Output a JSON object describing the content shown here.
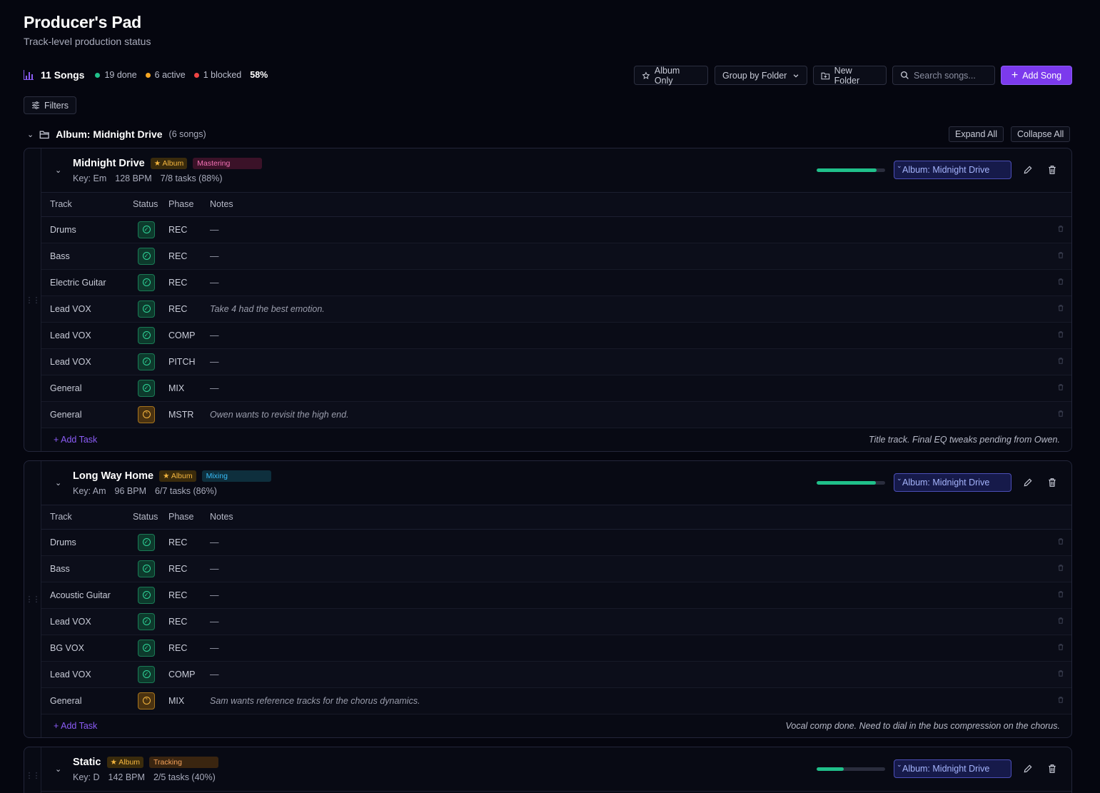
{
  "app": {
    "title": "Producer's Pad",
    "subtitle": "Track-level production status"
  },
  "stats": {
    "songs": "11 Songs",
    "done": "19 done",
    "active": "6 active",
    "blocked": "1 blocked",
    "percent": "58%",
    "colors": {
      "done": "#20c08a",
      "active": "#f5a623",
      "blocked": "#ef4444"
    }
  },
  "toolbar": {
    "album_only": "Album Only",
    "group_by": "Group by Folder",
    "new_folder": "New Folder",
    "search_placeholder": "Search songs...",
    "add_song": "Add Song"
  },
  "filters": {
    "label": "Filters"
  },
  "folder": {
    "title": "Album: Midnight Drive",
    "count": "(6 songs)",
    "expand_all": "Expand All",
    "collapse_all": "Collapse All"
  },
  "columns": {
    "track": "Track",
    "status": "Status",
    "phase": "Phase",
    "notes": "Notes"
  },
  "add_task": "Add Task",
  "songs": [
    {
      "title": "Midnight Drive",
      "album_badge": "Album",
      "phase": "Mastering",
      "phase_bg": "#3b1228",
      "phase_fg": "#f472b6",
      "key": "Key: Em",
      "bpm": "128 BPM",
      "tasks": "7/8 tasks (88%)",
      "progress": 0.88,
      "folder": "Album: Midnight Drive",
      "rows": [
        {
          "track": "Drums",
          "status": "done",
          "phase": "REC",
          "notes": "—"
        },
        {
          "track": "Bass",
          "status": "done",
          "phase": "REC",
          "notes": "—"
        },
        {
          "track": "Electric Guitar",
          "status": "done",
          "phase": "REC",
          "notes": "—"
        },
        {
          "track": "Lead VOX",
          "status": "done",
          "phase": "REC",
          "notes": "Take 4 had the best emotion."
        },
        {
          "track": "Lead VOX",
          "status": "done",
          "phase": "COMP",
          "notes": "—"
        },
        {
          "track": "Lead VOX",
          "status": "done",
          "phase": "PITCH",
          "notes": "—"
        },
        {
          "track": "General",
          "status": "done",
          "phase": "MIX",
          "notes": "—"
        },
        {
          "track": "General",
          "status": "active",
          "phase": "MSTR",
          "notes": "Owen wants to revisit the high end."
        }
      ],
      "footer_note": "Title track. Final EQ tweaks pending from Owen."
    },
    {
      "title": "Long Way Home",
      "album_badge": "Album",
      "phase": "Mixing",
      "phase_bg": "#0e2f3d",
      "phase_fg": "#38bdf8",
      "key": "Key: Am",
      "bpm": "96 BPM",
      "tasks": "6/7 tasks (86%)",
      "progress": 0.86,
      "folder": "Album: Midnight Drive",
      "rows": [
        {
          "track": "Drums",
          "status": "done",
          "phase": "REC",
          "notes": "—"
        },
        {
          "track": "Bass",
          "status": "done",
          "phase": "REC",
          "notes": "—"
        },
        {
          "track": "Acoustic Guitar",
          "status": "done",
          "phase": "REC",
          "notes": "—"
        },
        {
          "track": "Lead VOX",
          "status": "done",
          "phase": "REC",
          "notes": "—"
        },
        {
          "track": "BG VOX",
          "status": "done",
          "phase": "REC",
          "notes": "—"
        },
        {
          "track": "Lead VOX",
          "status": "done",
          "phase": "COMP",
          "notes": "—"
        },
        {
          "track": "General",
          "status": "active",
          "phase": "MIX",
          "notes": "Sam wants reference tracks for the chorus dynamics."
        }
      ],
      "footer_note": "Vocal comp done. Need to dial in the bus compression on the chorus."
    },
    {
      "title": "Static",
      "album_badge": "Album",
      "phase": "Tracking",
      "phase_bg": "#3a2510",
      "phase_fg": "#f5a25a",
      "key": "Key: D",
      "bpm": "142 BPM",
      "tasks": "2/5 tasks (40%)",
      "progress": 0.4,
      "folder": "Album: Midnight Drive",
      "rows": [],
      "footer_note": ""
    }
  ]
}
